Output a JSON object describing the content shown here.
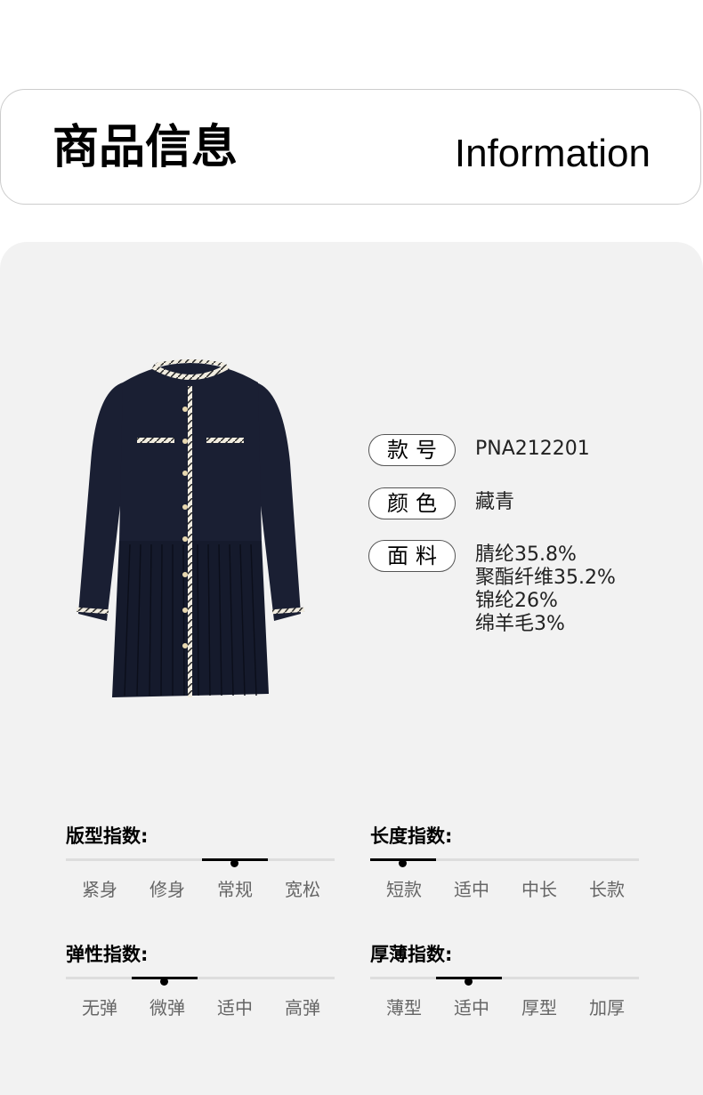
{
  "header": {
    "title_cn": "商品信息",
    "title_en": "Information"
  },
  "specs": [
    {
      "label": "款号",
      "values": [
        "PNA212201"
      ]
    },
    {
      "label": "颜色",
      "values": [
        "藏青"
      ]
    },
    {
      "label": "面料",
      "values": [
        "腈纶35.8%",
        "聚酯纤维35.2%",
        "锦纶26%",
        "绵羊毛3%"
      ]
    }
  ],
  "indices": [
    {
      "title": "版型指数:",
      "options": [
        "紧身",
        "修身",
        "常规",
        "宽松"
      ],
      "selected": "常规"
    },
    {
      "title": "长度指数:",
      "options": [
        "短款",
        "适中",
        "中长",
        "长款"
      ],
      "selected": "短款"
    },
    {
      "title": "弹性指数:",
      "options": [
        "无弹",
        "微弹",
        "适中",
        "高弹"
      ],
      "selected": "微弹"
    },
    {
      "title": "厚薄指数:",
      "options": [
        "薄型",
        "适中",
        "厚型",
        "加厚"
      ],
      "selected": "适中"
    }
  ],
  "colors": {
    "panel_bg": "#f2f2f2",
    "dress": "#1a1f33",
    "trim": "#efe9dc"
  }
}
